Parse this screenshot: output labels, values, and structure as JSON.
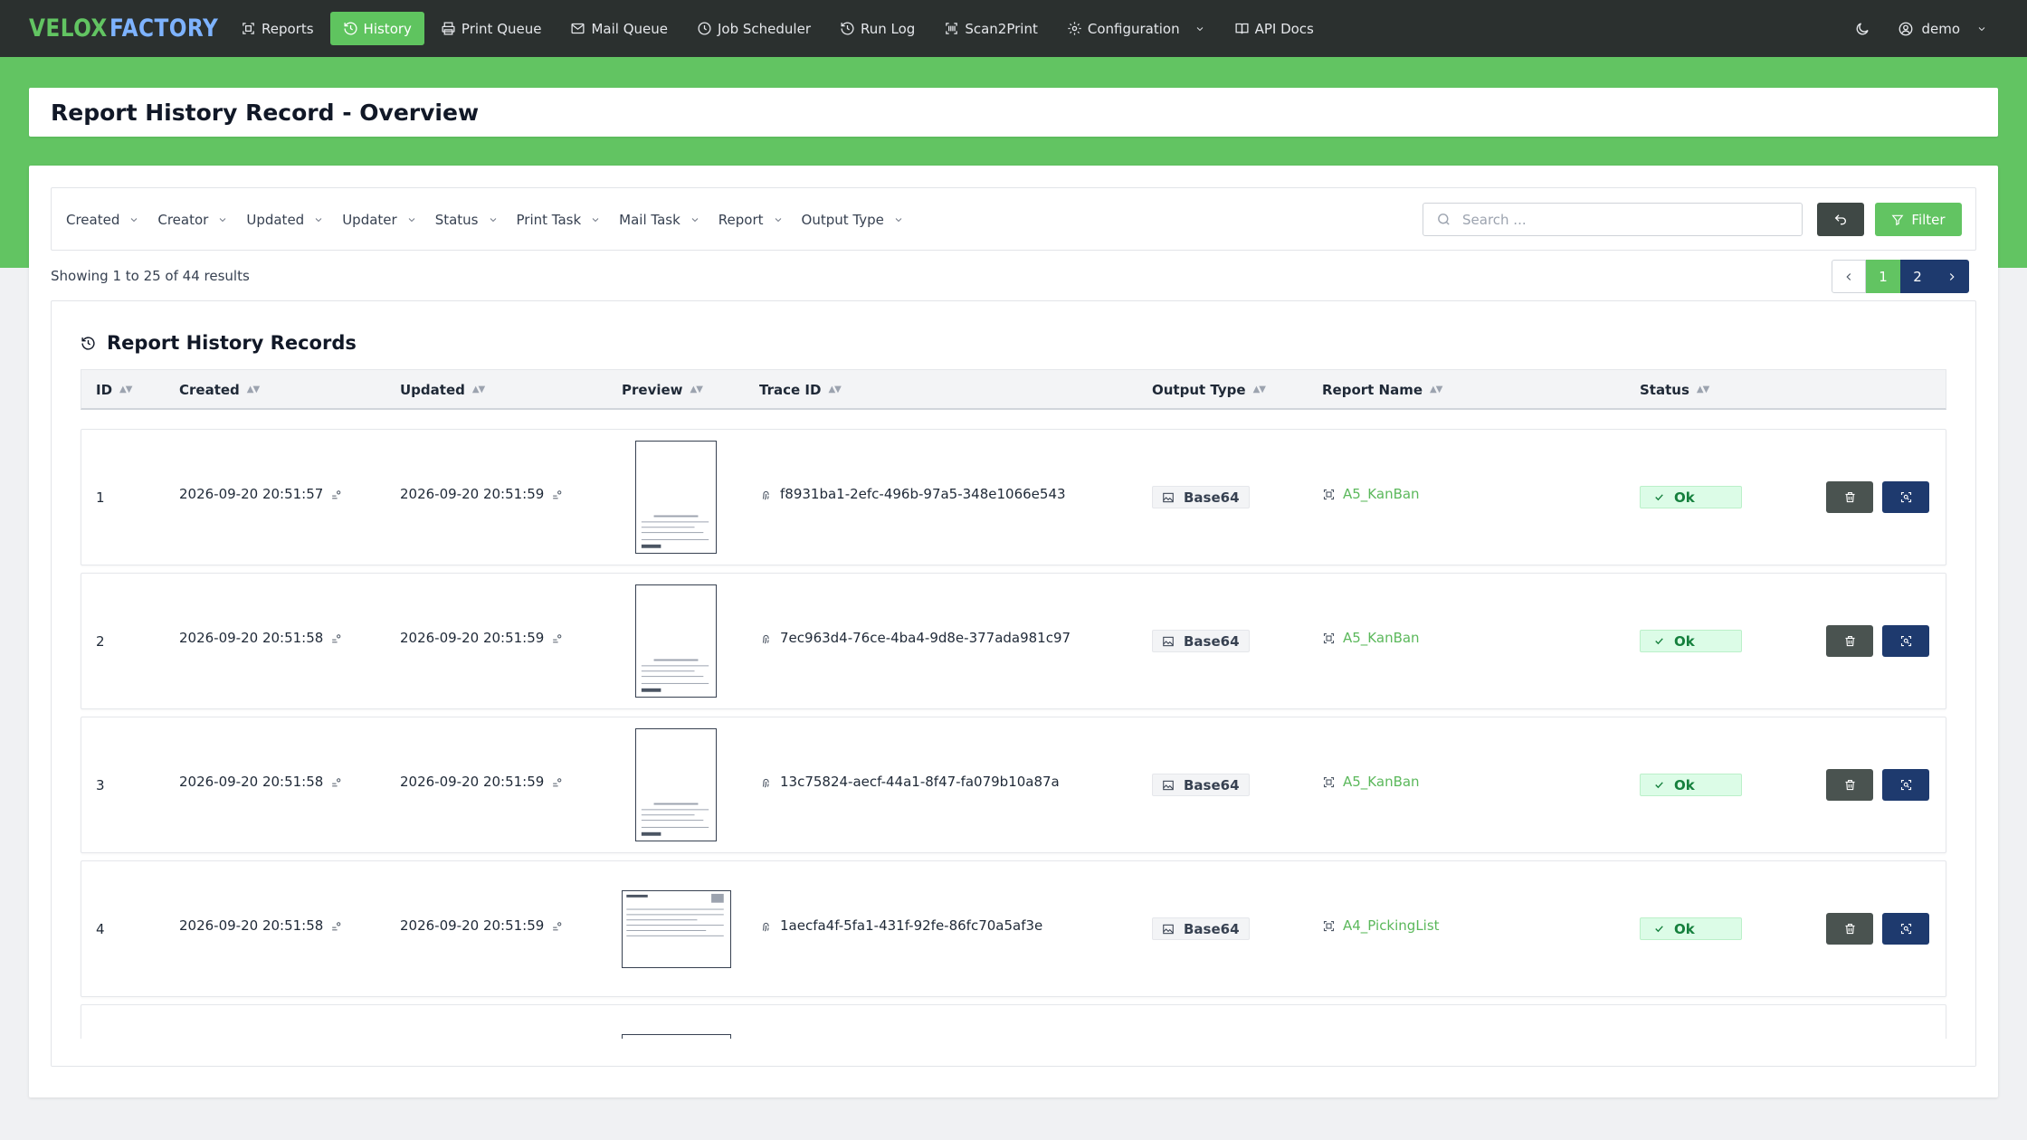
{
  "nav": {
    "logo_word1": "VELOX",
    "logo_word2": "FACTORY",
    "items": [
      {
        "label": "Reports",
        "icon": "scan-icon"
      },
      {
        "label": "History",
        "icon": "history-icon"
      },
      {
        "label": "Print Queue",
        "icon": "printer-icon"
      },
      {
        "label": "Mail Queue",
        "icon": "mail-icon"
      },
      {
        "label": "Job Scheduler",
        "icon": "clock-icon"
      },
      {
        "label": "Run Log",
        "icon": "history-icon"
      },
      {
        "label": "Scan2Print",
        "icon": "barcode-icon"
      },
      {
        "label": "Configuration",
        "icon": "gear-icon"
      },
      {
        "label": "API Docs",
        "icon": "book-icon"
      }
    ],
    "active_index": 1,
    "user_label": "demo"
  },
  "page_title": "Report History Record - Overview",
  "filters": [
    "Created",
    "Creator",
    "Updated",
    "Updater",
    "Status",
    "Print Task",
    "Mail Task",
    "Report",
    "Output Type"
  ],
  "search": {
    "placeholder": "Search ...",
    "value": ""
  },
  "filter_button_label": "Filter",
  "showing_text": "Showing 1 to 25 of 44 results",
  "pagination": {
    "pages": [
      "1",
      "2"
    ],
    "current": "1"
  },
  "table": {
    "title": "Report History Records",
    "columns": [
      "ID",
      "Created",
      "Updated",
      "Preview",
      "Trace ID",
      "Output Type",
      "Report Name",
      "Status"
    ],
    "rows": [
      {
        "id": "1",
        "created": "2026-09-20 20:51:57",
        "updated": "2026-09-20 20:51:59",
        "trace_id": "f8931ba1-2efc-496b-97a5-348e1066e543",
        "output_type": "Base64",
        "report_name": "A5_KanBan",
        "status": "Ok",
        "preview_orientation": "portrait"
      },
      {
        "id": "2",
        "created": "2026-09-20 20:51:58",
        "updated": "2026-09-20 20:51:59",
        "trace_id": "7ec963d4-76ce-4ba4-9d8e-377ada981c97",
        "output_type": "Base64",
        "report_name": "A5_KanBan",
        "status": "Ok",
        "preview_orientation": "portrait"
      },
      {
        "id": "3",
        "created": "2026-09-20 20:51:58",
        "updated": "2026-09-20 20:51:59",
        "trace_id": "13c75824-aecf-44a1-8f47-fa079b10a87a",
        "output_type": "Base64",
        "report_name": "A5_KanBan",
        "status": "Ok",
        "preview_orientation": "portrait"
      },
      {
        "id": "4",
        "created": "2026-09-20 20:51:58",
        "updated": "2026-09-20 20:51:59",
        "trace_id": "1aecfa4f-5fa1-431f-92fe-86fc70a5af3e",
        "output_type": "Base64",
        "report_name": "A4_PickingList",
        "status": "Ok",
        "preview_orientation": "landscape"
      }
    ]
  },
  "colors": {
    "nav_bg": "#2b302f",
    "accent_green": "#62c462",
    "navy": "#1e3a6e",
    "logo_blue": "#7eb3ff",
    "status_ok_bg": "#dcfce7",
    "status_ok_text": "#15803d"
  }
}
